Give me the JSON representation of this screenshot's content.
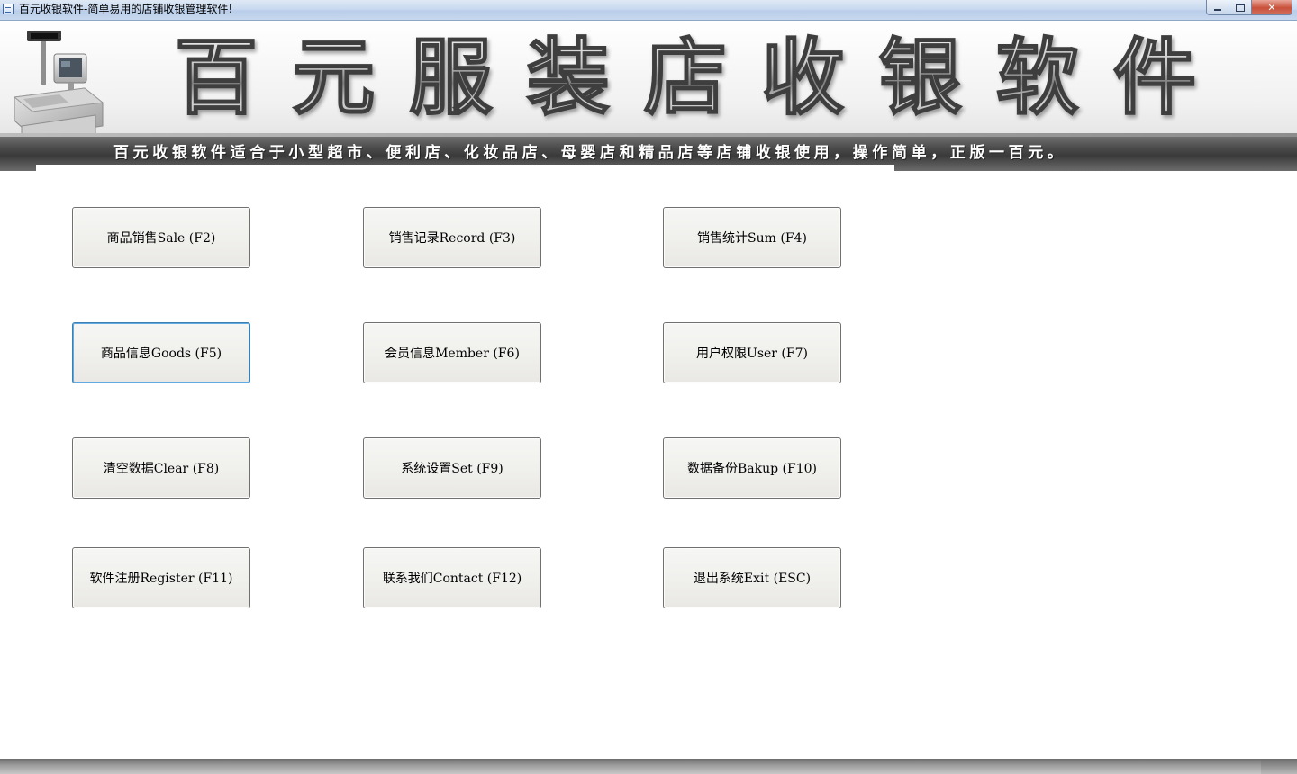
{
  "window": {
    "title": "百元收银软件-简单易用的店铺收银管理软件!",
    "controls": {
      "minimize": "minimize",
      "maximize": "maximize",
      "close_label": "✕"
    }
  },
  "banner": {
    "title_chars": [
      "百",
      "元",
      "服",
      "装",
      "店",
      "收",
      "银",
      "软",
      "件"
    ],
    "slogan": "百元收银软件适合于小型超市、便利店、化妆品店、母婴店和精品店等店铺收银使用，操作简单，正版一百元。",
    "image": "cash-register-icon"
  },
  "menu": {
    "buttons": [
      {
        "label": "商品销售Sale (F2)"
      },
      {
        "label": "销售记录Record (F3)"
      },
      {
        "label": "销售统计Sum (F4)"
      },
      {
        "label": "商品信息Goods (F5)"
      },
      {
        "label": "会员信息Member (F6)"
      },
      {
        "label": "用户权限User (F7)"
      },
      {
        "label": "清空数据Clear (F8)"
      },
      {
        "label": "系统设置Set (F9)"
      },
      {
        "label": "数据备份Bakup (F10)"
      },
      {
        "label": "软件注册Register (F11)"
      },
      {
        "label": "联系我们Contact (F12)"
      },
      {
        "label": "退出系统Exit (ESC)"
      }
    ]
  }
}
